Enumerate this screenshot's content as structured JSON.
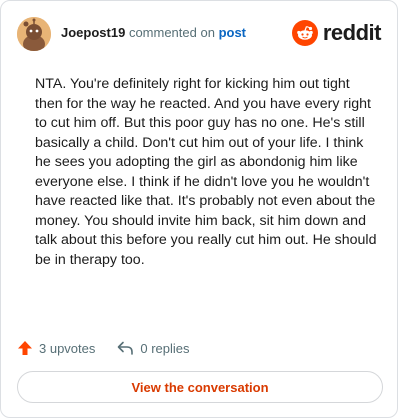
{
  "header": {
    "author": "Joepost19",
    "verb": "commented on",
    "post_link": "post",
    "brand": "reddit"
  },
  "comment": {
    "text": "NTA. You're definitely right for kicking him out tight then for the way he reacted. And you have every right to cut him off. But this poor guy has no one. He's still basically a child. Don't cut him out of your life. I think he sees you adopting the girl as abondonig him like everyone else. I think if he didn't love you he wouldn't have reacted like that. It's probably not even about the money. You should invite him back, sit him down and talk about this before you really cut him out. He should be in therapy too."
  },
  "footer": {
    "upvotes": "3 upvotes",
    "replies": "0 replies",
    "cta": "View the conversation"
  },
  "colors": {
    "brand_orange": "#ff4500",
    "link_blue": "#0a66c2",
    "cta_text": "#d93a00",
    "avatar_bg": "#e8b476"
  },
  "icons": {
    "avatar": "snoo-avatar",
    "logo": "reddit-snoo-icon",
    "upvote": "upvote-arrow-icon",
    "reply": "reply-arrow-icon"
  }
}
